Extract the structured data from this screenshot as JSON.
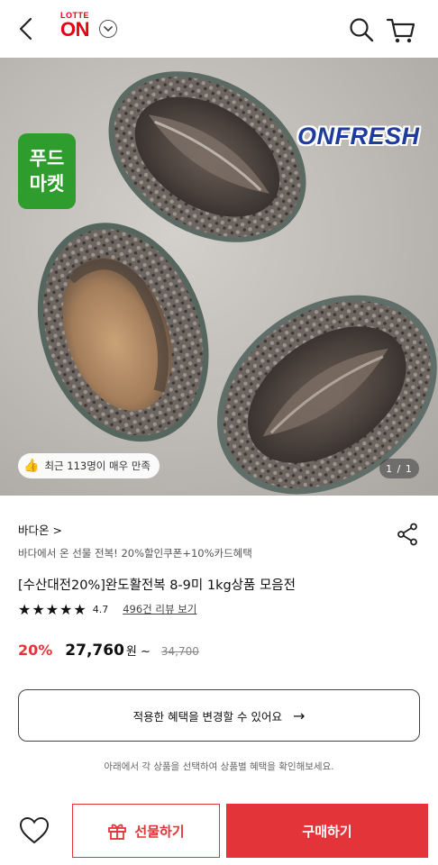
{
  "header": {
    "logo_top": "LOTTE",
    "logo_main": "ON",
    "icons": [
      "back-arrow-icon",
      "chevron-down-icon",
      "search-icon",
      "cart-icon"
    ]
  },
  "hero": {
    "badge_line1": "푸드",
    "badge_line2": "마켓",
    "brand_tag": "ONFRESH",
    "satisfaction": "최근 113명이 매우 만족",
    "pager": "1 / 1",
    "badge_color": "#2f9c2e",
    "brand_color": "#1e3c9b"
  },
  "product": {
    "store": "바다온",
    "store_chevron": ">",
    "promo": "바다에서 온 선물 전복! 20%할인쿠폰+10%카드혜택",
    "title": "[수산대전20%]완도활전복 8-9미 1kg상품 모음전",
    "rating": "4.7",
    "stars": "★★★★★",
    "review_link": "496건 리뷰 보기"
  },
  "price": {
    "discount": "20%",
    "sale_price": "27,760",
    "suffix": "원 ~",
    "original_price": "34,700",
    "accent_color": "#e3343a"
  },
  "benefit": {
    "button_label": "적용한 혜택을 변경할 수 있어요",
    "arrow": "→",
    "note": "아래에서 각 상품을 선택하여 상품별 혜택을 확인해보세요."
  },
  "bottom_bar": {
    "gift_label": "선물하기",
    "buy_label": "구매하기"
  }
}
